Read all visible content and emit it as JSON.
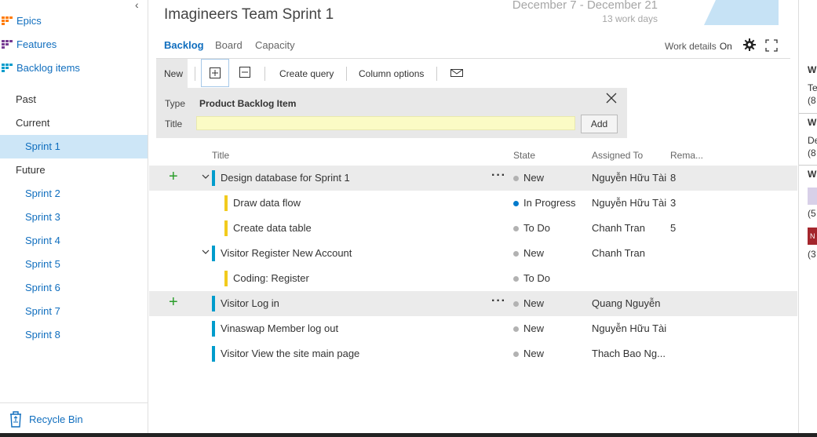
{
  "sidebar": {
    "collapse_glyph": "‹",
    "top_items": [
      {
        "label": "Epics",
        "icon": "epics-icon",
        "color": "#ff7b00"
      },
      {
        "label": "Features",
        "icon": "features-icon",
        "color": "#773b93"
      },
      {
        "label": "Backlog items",
        "icon": "backlog-items-icon",
        "color": "#009ccc"
      }
    ],
    "past_label": "Past",
    "current_label": "Current",
    "current_sprint": "Sprint 1",
    "future_label": "Future",
    "future_sprints": [
      "Sprint 2",
      "Sprint 3",
      "Sprint 4",
      "Sprint 5",
      "Sprint 6",
      "Sprint 7",
      "Sprint 8"
    ],
    "recycle_bin": "Recycle Bin"
  },
  "header": {
    "title": "Imagineers Team Sprint 1",
    "dates": "December 7 - December 21",
    "work_days": "13 work days"
  },
  "tabs": [
    "Backlog",
    "Board",
    "Capacity"
  ],
  "active_tab": "Backlog",
  "work_details": {
    "label": "Work details",
    "value": "On"
  },
  "toolbar": {
    "new_label": "New",
    "create_query": "Create query",
    "column_options": "Column options"
  },
  "add_panel": {
    "type_label": "Type",
    "type_value": "Product Backlog Item",
    "title_label": "Title",
    "title_value": "",
    "add_button": "Add"
  },
  "columns": {
    "title": "Title",
    "state": "State",
    "assigned": "Assigned To",
    "remaining": "Rema..."
  },
  "rows": [
    {
      "title": "Design database for Sprint 1",
      "state": "New",
      "assigned": "Nguyễn Hữu Tài",
      "remaining": "8",
      "level": 0,
      "kind": "pbi",
      "expanded": true,
      "highlight": true,
      "plus": true,
      "dots": true
    },
    {
      "title": "Draw data flow",
      "state": "In Progress",
      "assigned": "Nguyễn Hữu Tài",
      "remaining": "3",
      "level": 1,
      "kind": "task"
    },
    {
      "title": "Create data table",
      "state": "To Do",
      "assigned": "Chanh Tran",
      "remaining": "5",
      "level": 1,
      "kind": "task"
    },
    {
      "title": "Visitor Register New Account",
      "state": "New",
      "assigned": "Chanh Tran",
      "remaining": "",
      "level": 0,
      "kind": "pbi",
      "expanded": true
    },
    {
      "title": "Coding: Register",
      "state": "To Do",
      "assigned": "",
      "remaining": "",
      "level": 1,
      "kind": "task"
    },
    {
      "title": "Visitor Log in",
      "state": "New",
      "assigned": "Quang Nguyễn",
      "remaining": "",
      "level": 0,
      "kind": "pbi",
      "highlight": true,
      "plus": true,
      "dots": true
    },
    {
      "title": "Vinaswap Member log out",
      "state": "New",
      "assigned": "Nguyễn Hữu Tài",
      "remaining": "",
      "level": 0,
      "kind": "pbi"
    },
    {
      "title": "Visitor View the site main page",
      "state": "New",
      "assigned": "Thach Bao Ng...",
      "remaining": "",
      "level": 0,
      "kind": "pbi"
    }
  ],
  "colors": {
    "pbi_bar": "#009ccc",
    "task_bar": "#f2cb1d",
    "state_new": "#b2b2b2",
    "state_in_progress": "#007acc",
    "state_todo": "#b2b2b2",
    "link": "#106ebe",
    "plus": "#2a9d2a"
  },
  "right_panel": {
    "items": [
      {
        "text": "W",
        "bold": true
      },
      {
        "text": "Tea"
      },
      {
        "text": "(8"
      },
      {
        "text": "W",
        "bold": true
      },
      {
        "text": "De"
      },
      {
        "text": "(8"
      },
      {
        "text": "W",
        "bold": true
      },
      {
        "text": "(5"
      },
      {
        "text": "N",
        "badge": true
      },
      {
        "text": "(3"
      }
    ]
  }
}
